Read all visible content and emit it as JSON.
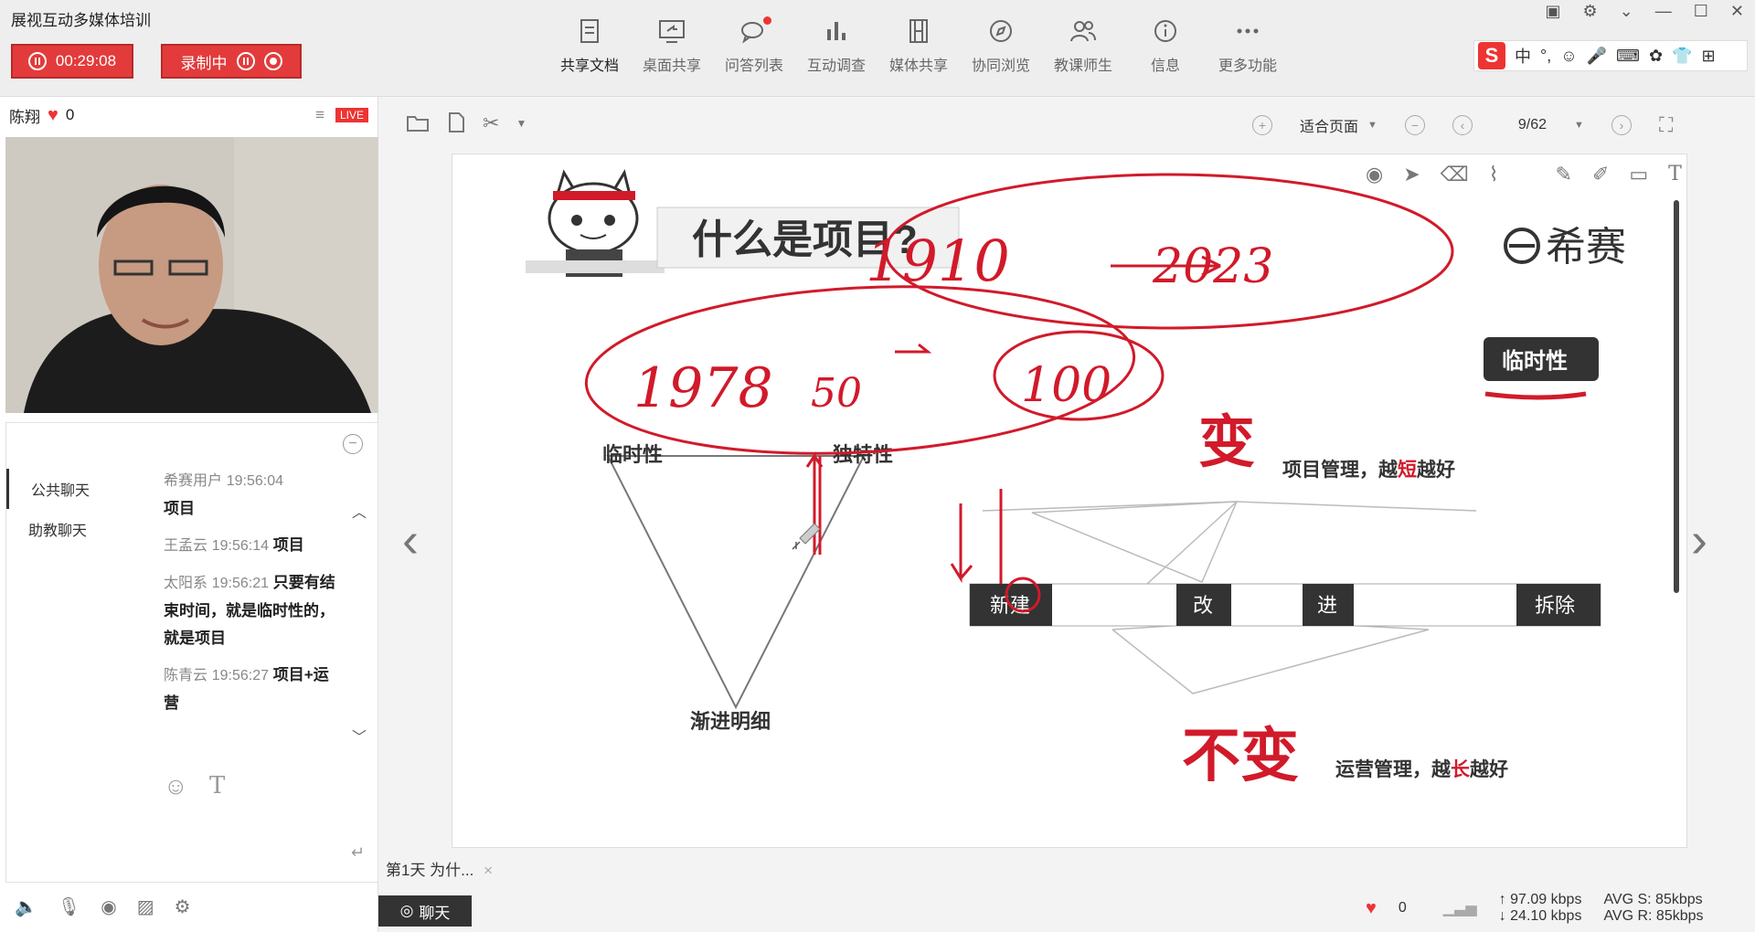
{
  "app": {
    "title": "展视互动多媒体培训"
  },
  "timer": {
    "value": "00:29:08"
  },
  "record": {
    "label": "录制中"
  },
  "toolbar": {
    "items": [
      {
        "label": "共享文档",
        "icon": "doc-icon"
      },
      {
        "label": "桌面共享",
        "icon": "screen-share-icon"
      },
      {
        "label": "问答列表",
        "icon": "qa-icon"
      },
      {
        "label": "互动调查",
        "icon": "poll-icon"
      },
      {
        "label": "媒体共享",
        "icon": "film-icon"
      },
      {
        "label": "协同浏览",
        "icon": "compass-icon"
      },
      {
        "label": "教课师生",
        "icon": "users-icon"
      },
      {
        "label": "信息",
        "icon": "info-icon"
      },
      {
        "label": "更多功能",
        "icon": "more-icon"
      }
    ]
  },
  "ime": {
    "lang": "中",
    "punct": "°,"
  },
  "presenter": {
    "name": "陈翔",
    "likes": "0",
    "live": "LIVE"
  },
  "chat": {
    "tabs": [
      "公共聊天",
      "助教聊天"
    ],
    "messages": [
      {
        "user": "希赛用户",
        "time": "19:56:04",
        "text": "项目"
      },
      {
        "user": "王孟云",
        "time": "19:56:14",
        "text": "项目"
      },
      {
        "user": "太阳系",
        "time": "19:56:21",
        "text": "只要有结束时间，就是临时性的，就是项目"
      },
      {
        "user": "陈青云",
        "time": "19:56:27",
        "text": "项目+运营"
      }
    ]
  },
  "view": {
    "fit": "适合页面",
    "page": "9/62"
  },
  "slide": {
    "title": "什么是项目?",
    "brand": "希赛",
    "badge": "临时性",
    "labels": {
      "temporary": "临时性",
      "unique": "独特性",
      "progressive": "渐进明细"
    },
    "change": {
      "big": "变",
      "text_pre": "项目管理，越",
      "text_hl": "短",
      "text_post": "越好"
    },
    "nochange": {
      "big": "不变",
      "text_pre": "运营管理，越",
      "text_hl": "长",
      "text_post": "越好"
    },
    "timeline": [
      "新建",
      "改",
      "进",
      "拆除"
    ],
    "handwriting": {
      "a": "1910",
      "b": "2023",
      "c": "1978",
      "d": "50",
      "e": "100"
    }
  },
  "bottom": {
    "doctab": "第1天 为什...",
    "chat_button": "聊天",
    "likes": "0",
    "up": "97.09 kbps",
    "down": "24.10 kbps",
    "avg_s": "AVG S: 85kbps",
    "avg_r": "AVG R: 85kbps"
  },
  "colors": {
    "accent": "#e33b3b",
    "ink": "#d11a2a"
  }
}
